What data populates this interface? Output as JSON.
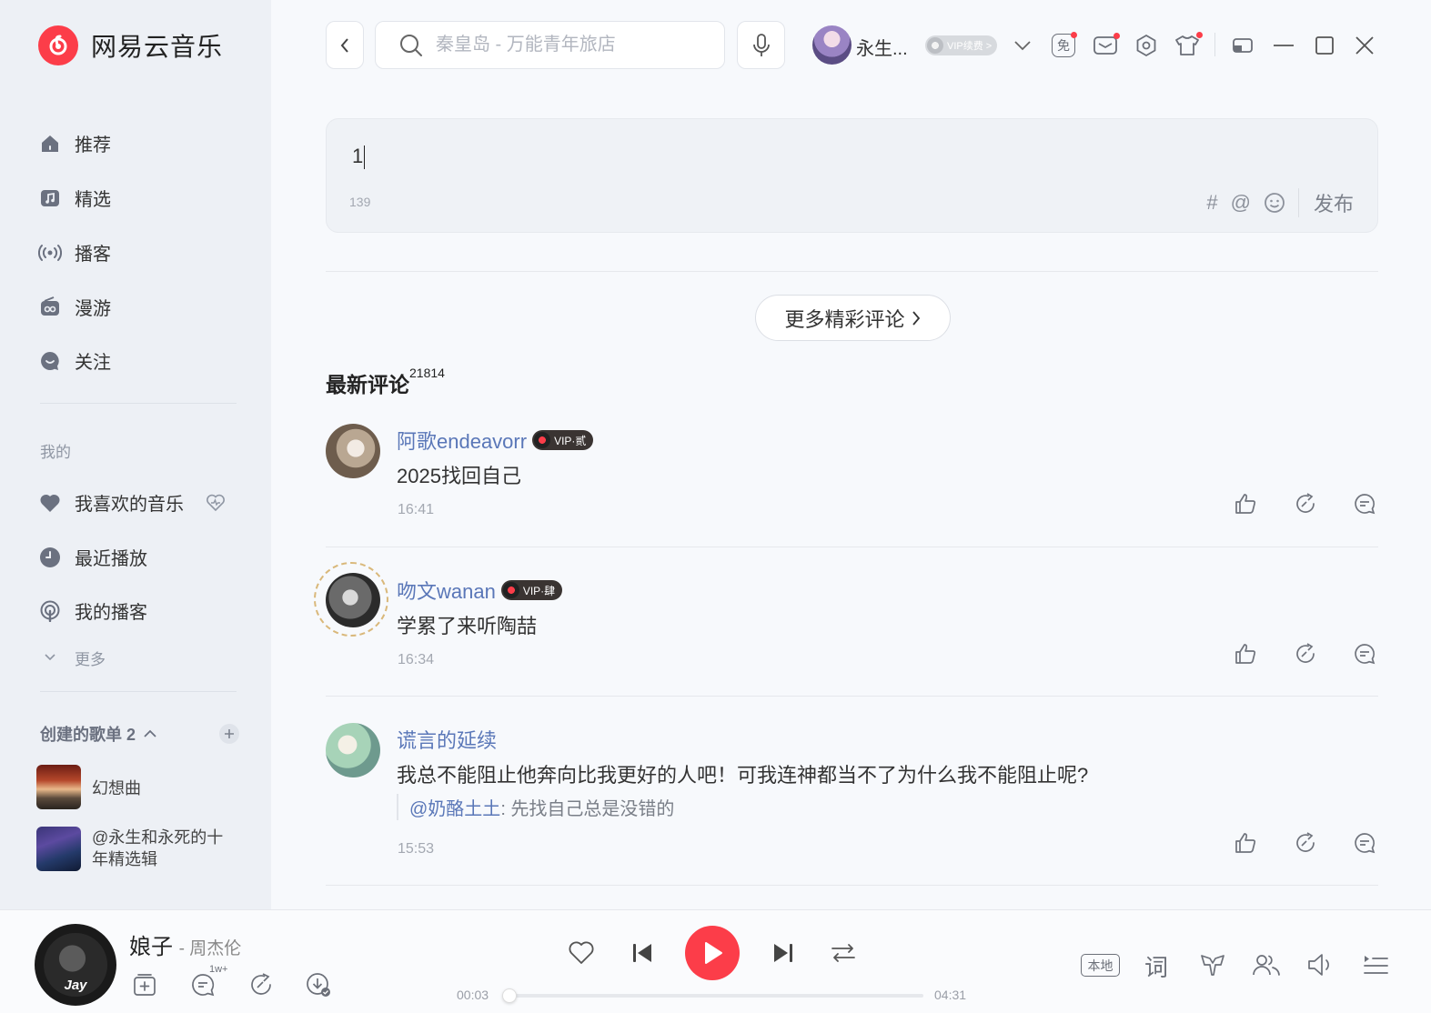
{
  "app": {
    "name": "网易云音乐",
    "accent_color": "#fc3d49"
  },
  "sidebar": {
    "nav": [
      {
        "label": "推荐",
        "icon": "home-icon"
      },
      {
        "label": "精选",
        "icon": "music-note-icon"
      },
      {
        "label": "播客",
        "icon": "broadcast-icon"
      },
      {
        "label": "漫游",
        "icon": "radio-icon"
      },
      {
        "label": "关注",
        "icon": "chat-bubble-icon"
      }
    ],
    "my_section_label": "我的",
    "my_items": [
      {
        "label": "我喜欢的音乐",
        "icon": "heart-icon"
      },
      {
        "label": "最近播放",
        "icon": "clock-icon"
      },
      {
        "label": "我的播客",
        "icon": "podcast-icon"
      }
    ],
    "more_label": "更多",
    "created_playlists_label": "创建的歌单 2",
    "playlists": [
      {
        "title": "幻想曲"
      },
      {
        "title": "@永生和永死的十年精选辑"
      }
    ]
  },
  "topbar": {
    "search_placeholder": "秦皇岛 - 万能青年旅店",
    "username": "永生...",
    "vip_renew_label": "VIP续费 >",
    "free_badge": "免"
  },
  "editor": {
    "text": "1",
    "char_count": "139",
    "publish_label": "发布",
    "hash_symbol": "#",
    "at_symbol": "@"
  },
  "comments_section": {
    "more_button_label": "更多精彩评论",
    "latest_title": "最新评论",
    "latest_count": "21814"
  },
  "comments": [
    {
      "username": "阿歌endeavorr",
      "vip_label": "VIP·贰",
      "text": "2025找回自己",
      "time": "16:41"
    },
    {
      "username": "吻文wanan",
      "vip_label": "VIP·肆",
      "text": "学累了来听陶喆",
      "time": "16:34"
    },
    {
      "username": "谎言的延续",
      "vip_label": "",
      "text": "我总不能阻止他奔向比我更好的人吧！可我连神都当不了为什么我不能阻止呢?",
      "reply_user": "@奶酪土土",
      "reply_text": ": 先找自己总是没错的",
      "time": "15:53"
    }
  ],
  "player": {
    "song_title": "娘子",
    "artist": "- 周杰伦",
    "cover_label": "Jay",
    "comment_count": "1w+",
    "current_time": "00:03",
    "total_time": "04:31",
    "progress": 0.011,
    "local_label": "本地",
    "lyric_label": "词"
  }
}
